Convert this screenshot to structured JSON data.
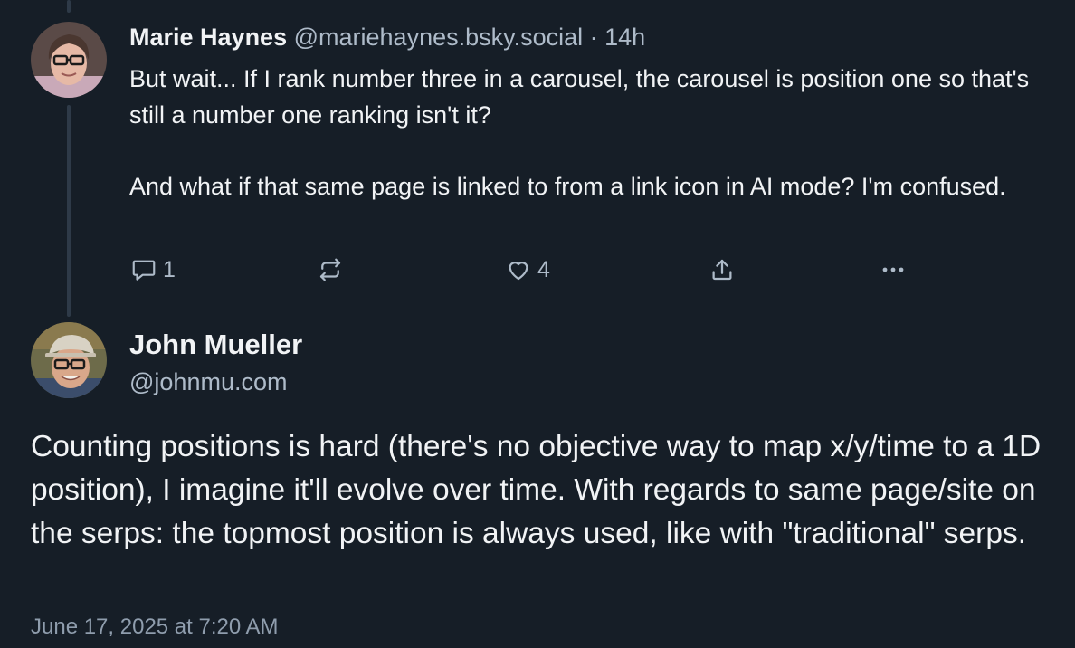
{
  "reply": {
    "author_name": "Marie Haynes",
    "author_handle": "@mariehaynes.bsky.social",
    "separator": " · ",
    "time": "14h",
    "paragraphs": [
      "But wait... If I rank number three in a carousel, the carousel is position one so that's still a number one ranking isn't it?",
      "And what if that same page is linked to from a link icon in AI mode? I'm confused."
    ],
    "reply_count": "1",
    "like_count": "4",
    "icons": [
      "reply-icon",
      "repost-icon",
      "like-icon",
      "share-icon",
      "more-icon"
    ]
  },
  "main_post": {
    "author_name": "John Mueller",
    "author_handle": "@johnmu.com",
    "text": "Counting positions is hard (there's no objective way to map x/y/time to a 1D position), I imagine it'll evolve over time. With regards to same page/site on the serps: the topmost position is always used, like with \"traditional\" serps.",
    "date": "June 17, 2025 at 7:20 AM"
  },
  "colors": {
    "background": "#161e27",
    "text_primary": "#f1f3f5",
    "text_secondary": "#aebbc9",
    "thread_line": "#2e3a48"
  }
}
